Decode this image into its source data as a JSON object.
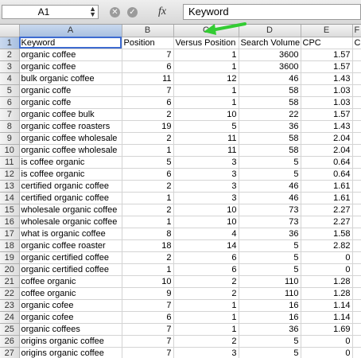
{
  "formula_bar": {
    "name_box": "A1",
    "cancel_glyph": "✕",
    "confirm_glyph": "✓",
    "fx_label": "fx",
    "content": "Keyword"
  },
  "columns": [
    "A",
    "B",
    "C",
    "D",
    "E",
    "F"
  ],
  "headers": [
    "Keyword",
    "Position",
    "Versus Position",
    "Search Volume",
    "CPC",
    "C"
  ],
  "rows": [
    [
      "organic coffee",
      "7",
      "1",
      "3600",
      "1.57"
    ],
    [
      "organic coffee",
      "6",
      "1",
      "3600",
      "1.57"
    ],
    [
      "bulk organic coffee",
      "11",
      "12",
      "46",
      "1.43"
    ],
    [
      "organic coffe",
      "7",
      "1",
      "58",
      "1.03"
    ],
    [
      "organic coffe",
      "6",
      "1",
      "58",
      "1.03"
    ],
    [
      "organic coffee bulk",
      "2",
      "10",
      "22",
      "1.57"
    ],
    [
      "organic coffee roasters",
      "19",
      "5",
      "36",
      "1.43"
    ],
    [
      "organic coffee wholesale",
      "2",
      "11",
      "58",
      "2.04"
    ],
    [
      "organic coffee wholesale",
      "1",
      "11",
      "58",
      "2.04"
    ],
    [
      "is coffee organic",
      "5",
      "3",
      "5",
      "0.64"
    ],
    [
      "is coffee organic",
      "6",
      "3",
      "5",
      "0.64"
    ],
    [
      "certified organic coffee",
      "2",
      "3",
      "46",
      "1.61"
    ],
    [
      "certified organic coffee",
      "1",
      "3",
      "46",
      "1.61"
    ],
    [
      "wholesale organic coffee",
      "2",
      "10",
      "73",
      "2.27"
    ],
    [
      "wholesale organic coffee",
      "1",
      "10",
      "73",
      "2.27"
    ],
    [
      "what is organic coffee",
      "8",
      "4",
      "36",
      "1.58"
    ],
    [
      "organic coffee roaster",
      "18",
      "14",
      "5",
      "2.82"
    ],
    [
      "organic certified coffee",
      "2",
      "6",
      "5",
      "0"
    ],
    [
      "organic certified coffee",
      "1",
      "6",
      "5",
      "0"
    ],
    [
      "coffee organic",
      "10",
      "2",
      "110",
      "1.28"
    ],
    [
      "coffee organic",
      "9",
      "2",
      "110",
      "1.28"
    ],
    [
      "organic cofee",
      "7",
      "1",
      "16",
      "1.14"
    ],
    [
      "organic cofee",
      "6",
      "1",
      "16",
      "1.14"
    ],
    [
      "organic coffees",
      "7",
      "1",
      "36",
      "1.69"
    ],
    [
      "origins organic coffee",
      "7",
      "2",
      "5",
      "0"
    ],
    [
      "origins organic coffee",
      "7",
      "3",
      "5",
      "0"
    ]
  ],
  "colors": {
    "selection_outline": "#3d6bd0",
    "annotation_arrow": "#33cc33"
  }
}
